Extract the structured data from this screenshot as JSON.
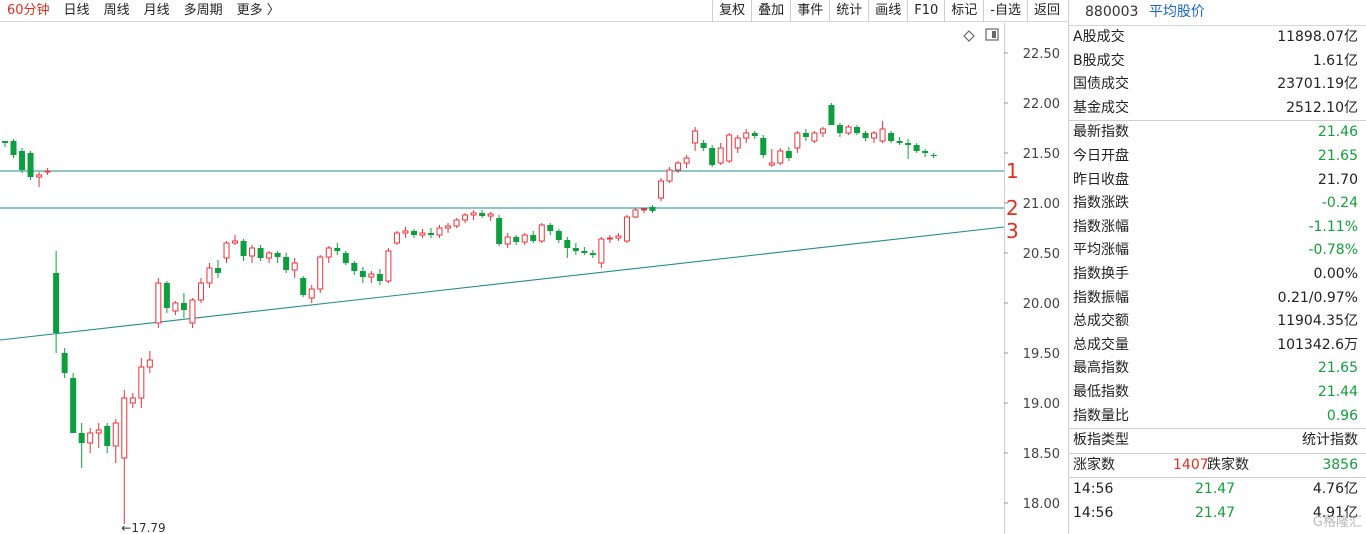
{
  "toolbar": {
    "periods": [
      "60分钟",
      "日线",
      "周线",
      "月线",
      "多周期",
      "更多 〉"
    ],
    "active_period": "60分钟",
    "buttons": [
      "复权",
      "叠加",
      "事件",
      "统计",
      "画线",
      "F10",
      "标记",
      "-自选",
      "返回"
    ]
  },
  "chart_icons": [
    "diamond-icon",
    "panel-toggle-icon"
  ],
  "chart_data": {
    "type": "candlestick",
    "y_axis": {
      "ticks": [
        22.5,
        22.0,
        21.5,
        21.0,
        20.5,
        20.0,
        19.5,
        19.0,
        18.5,
        18.0
      ],
      "range": [
        17.75,
        22.75
      ]
    },
    "up_color": "#e8333c",
    "down_color": "#0d9f3f",
    "min_annotation": "←17.79",
    "min_value": 17.79,
    "horizontal_lines": [
      {
        "label": "1",
        "value": 21.32
      },
      {
        "label": "2",
        "value": 20.95
      }
    ],
    "trend_line": {
      "label": "3",
      "start": 19.63,
      "end": 20.76
    },
    "candles": [
      [
        21.62,
        21.62,
        21.56,
        21.6
      ],
      [
        21.62,
        21.64,
        21.45,
        21.48
      ],
      [
        21.52,
        21.55,
        21.3,
        21.33
      ],
      [
        21.5,
        21.52,
        21.23,
        21.26
      ],
      [
        21.26,
        21.31,
        21.16,
        21.28
      ],
      [
        21.31,
        21.35,
        21.28,
        21.32
      ],
      [
        20.3,
        20.52,
        19.5,
        19.7
      ],
      [
        19.5,
        19.55,
        19.25,
        19.3
      ],
      [
        19.25,
        19.3,
        18.7,
        18.7
      ],
      [
        18.7,
        18.8,
        18.35,
        18.6
      ],
      [
        18.6,
        18.75,
        18.5,
        18.7
      ],
      [
        18.7,
        18.8,
        18.55,
        18.73
      ],
      [
        18.77,
        18.8,
        18.5,
        18.57
      ],
      [
        18.57,
        18.84,
        18.4,
        18.8
      ],
      [
        18.45,
        19.13,
        17.79,
        19.05
      ],
      [
        19.0,
        19.1,
        18.95,
        19.05
      ],
      [
        19.05,
        19.45,
        18.95,
        19.36
      ],
      [
        19.36,
        19.52,
        19.3,
        19.43
      ],
      [
        19.8,
        20.25,
        19.75,
        20.2
      ],
      [
        20.2,
        20.22,
        19.9,
        19.95
      ],
      [
        19.92,
        20.02,
        19.88,
        20.0
      ],
      [
        20.0,
        20.1,
        19.85,
        19.93
      ],
      [
        19.8,
        20.05,
        19.75,
        20.03
      ],
      [
        20.03,
        20.25,
        20.0,
        20.2
      ],
      [
        20.2,
        20.4,
        20.15,
        20.35
      ],
      [
        20.35,
        20.43,
        20.25,
        20.3
      ],
      [
        20.45,
        20.62,
        20.4,
        20.6
      ],
      [
        20.6,
        20.68,
        20.58,
        20.62
      ],
      [
        20.62,
        20.64,
        20.42,
        20.47
      ],
      [
        20.47,
        20.58,
        20.4,
        20.55
      ],
      [
        20.55,
        20.58,
        20.42,
        20.45
      ],
      [
        20.45,
        20.52,
        20.4,
        20.5
      ],
      [
        20.5,
        20.52,
        20.4,
        20.46
      ],
      [
        20.46,
        20.5,
        20.3,
        20.33
      ],
      [
        20.33,
        20.45,
        20.25,
        20.4
      ],
      [
        20.25,
        20.27,
        20.06,
        20.08
      ],
      [
        20.05,
        20.18,
        20.0,
        20.14
      ],
      [
        20.14,
        20.48,
        20.1,
        20.46
      ],
      [
        20.46,
        20.57,
        20.4,
        20.55
      ],
      [
        20.55,
        20.6,
        20.48,
        20.52
      ],
      [
        20.5,
        20.52,
        20.38,
        20.4
      ],
      [
        20.4,
        20.42,
        20.28,
        20.32
      ],
      [
        20.32,
        20.36,
        20.2,
        20.26
      ],
      [
        20.26,
        20.32,
        20.2,
        20.29
      ],
      [
        20.29,
        20.34,
        20.18,
        20.22
      ],
      [
        20.22,
        20.55,
        20.2,
        20.52
      ],
      [
        20.6,
        20.72,
        20.58,
        20.7
      ],
      [
        20.7,
        20.76,
        20.65,
        20.72
      ],
      [
        20.72,
        20.74,
        20.65,
        20.68
      ],
      [
        20.68,
        20.74,
        20.65,
        20.7
      ],
      [
        20.7,
        20.75,
        20.65,
        20.68
      ],
      [
        20.68,
        20.78,
        20.65,
        20.75
      ],
      [
        20.75,
        20.8,
        20.7,
        20.77
      ],
      [
        20.77,
        20.85,
        20.75,
        20.83
      ],
      [
        20.83,
        20.9,
        20.8,
        20.88
      ],
      [
        20.88,
        20.93,
        20.83,
        20.9
      ],
      [
        20.9,
        20.93,
        20.85,
        20.87
      ],
      [
        20.87,
        20.91,
        20.82,
        20.89
      ],
      [
        20.85,
        20.88,
        20.57,
        20.59
      ],
      [
        20.59,
        20.7,
        20.55,
        20.66
      ],
      [
        20.66,
        20.68,
        20.58,
        20.61
      ],
      [
        20.61,
        20.7,
        20.58,
        20.68
      ],
      [
        20.68,
        20.72,
        20.6,
        20.62
      ],
      [
        20.62,
        20.8,
        20.6,
        20.78
      ],
      [
        20.78,
        20.8,
        20.68,
        20.72
      ],
      [
        20.72,
        20.74,
        20.6,
        20.63
      ],
      [
        20.63,
        20.66,
        20.45,
        20.55
      ],
      [
        20.55,
        20.6,
        20.48,
        20.52
      ],
      [
        20.52,
        20.56,
        20.48,
        20.5
      ],
      [
        20.5,
        20.53,
        20.45,
        20.48
      ],
      [
        20.4,
        20.66,
        20.35,
        20.64
      ],
      [
        20.64,
        20.68,
        20.6,
        20.65
      ],
      [
        20.65,
        20.7,
        20.62,
        20.67
      ],
      [
        20.62,
        20.88,
        20.6,
        20.86
      ],
      [
        20.86,
        20.95,
        20.85,
        20.93
      ],
      [
        20.93,
        20.95,
        20.9,
        20.94
      ],
      [
        20.96,
        20.98,
        20.9,
        20.92
      ],
      [
        21.05,
        21.25,
        21.02,
        21.22
      ],
      [
        21.22,
        21.36,
        21.2,
        21.33
      ],
      [
        21.33,
        21.42,
        21.3,
        21.4
      ],
      [
        21.4,
        21.48,
        21.35,
        21.45
      ],
      [
        21.6,
        21.76,
        21.52,
        21.72
      ],
      [
        21.6,
        21.63,
        21.52,
        21.55
      ],
      [
        21.55,
        21.58,
        21.36,
        21.38
      ],
      [
        21.4,
        21.6,
        21.38,
        21.55
      ],
      [
        21.42,
        21.7,
        21.4,
        21.68
      ],
      [
        21.55,
        21.68,
        21.5,
        21.65
      ],
      [
        21.65,
        21.74,
        21.6,
        21.7
      ],
      [
        21.7,
        21.72,
        21.64,
        21.67
      ],
      [
        21.65,
        21.68,
        21.45,
        21.48
      ],
      [
        21.38,
        21.54,
        21.36,
        21.4
      ],
      [
        21.4,
        21.55,
        21.38,
        21.52
      ],
      [
        21.52,
        21.56,
        21.42,
        21.45
      ],
      [
        21.55,
        21.72,
        21.5,
        21.7
      ],
      [
        21.7,
        21.74,
        21.62,
        21.66
      ],
      [
        21.62,
        21.72,
        21.6,
        21.7
      ],
      [
        21.7,
        21.76,
        21.66,
        21.74
      ],
      [
        21.98,
        22.0,
        21.78,
        21.78
      ],
      [
        21.78,
        21.8,
        21.66,
        21.7
      ],
      [
        21.7,
        21.78,
        21.68,
        21.76
      ],
      [
        21.76,
        21.78,
        21.68,
        21.7
      ],
      [
        21.7,
        21.72,
        21.62,
        21.65
      ],
      [
        21.65,
        21.72,
        21.6,
        21.7
      ],
      [
        21.62,
        21.82,
        21.6,
        21.74
      ],
      [
        21.7,
        21.72,
        21.6,
        21.62
      ],
      [
        21.62,
        21.66,
        21.58,
        21.6
      ],
      [
        21.6,
        21.64,
        21.44,
        21.58
      ],
      [
        21.58,
        21.6,
        21.5,
        21.52
      ],
      [
        21.52,
        21.54,
        21.46,
        21.5
      ],
      [
        21.48,
        21.5,
        21.45,
        21.47
      ]
    ]
  },
  "info": {
    "code": "880003",
    "name": "平均股价",
    "turnover": [
      {
        "label": "A股成交",
        "value": "11898.07亿"
      },
      {
        "label": "B股成交",
        "value": "1.61亿"
      },
      {
        "label": "国债成交",
        "value": "23701.19亿"
      },
      {
        "label": "基金成交",
        "value": "2512.10亿"
      }
    ],
    "stats": [
      {
        "label": "最新指数",
        "value": "21.46",
        "color": "green"
      },
      {
        "label": "今日开盘",
        "value": "21.65",
        "color": "green"
      },
      {
        "label": "昨日收盘",
        "value": "21.70",
        "color": "black"
      },
      {
        "label": "指数涨跌",
        "value": "-0.24",
        "color": "green"
      },
      {
        "label": "指数涨幅",
        "value": "-1.11%",
        "color": "green"
      },
      {
        "label": "平均涨幅",
        "value": "-0.78%",
        "color": "green"
      },
      {
        "label": "指数换手",
        "value": "0.00%",
        "color": "black"
      },
      {
        "label": "指数振幅",
        "value": "0.21/0.97%",
        "color": "black"
      },
      {
        "label": "总成交额",
        "value": "11904.35亿",
        "color": "black"
      },
      {
        "label": "总成交量",
        "value": "101342.6万",
        "color": "black"
      },
      {
        "label": "最高指数",
        "value": "21.65",
        "color": "green"
      },
      {
        "label": "最低指数",
        "value": "21.44",
        "color": "green"
      },
      {
        "label": "指数量比",
        "value": "0.96",
        "color": "green"
      }
    ],
    "board_type_label": "板指类型",
    "board_type_value": "统计指数",
    "up_label": "涨家数",
    "up_count": "1407",
    "down_label": "跌家数",
    "down_count": "3856",
    "ticks": [
      {
        "time": "14:56",
        "price": "21.47",
        "volume": "4.76亿"
      },
      {
        "time": "14:56",
        "price": "21.47",
        "volume": "4.91亿"
      }
    ],
    "watermark": "G格隆汇"
  }
}
